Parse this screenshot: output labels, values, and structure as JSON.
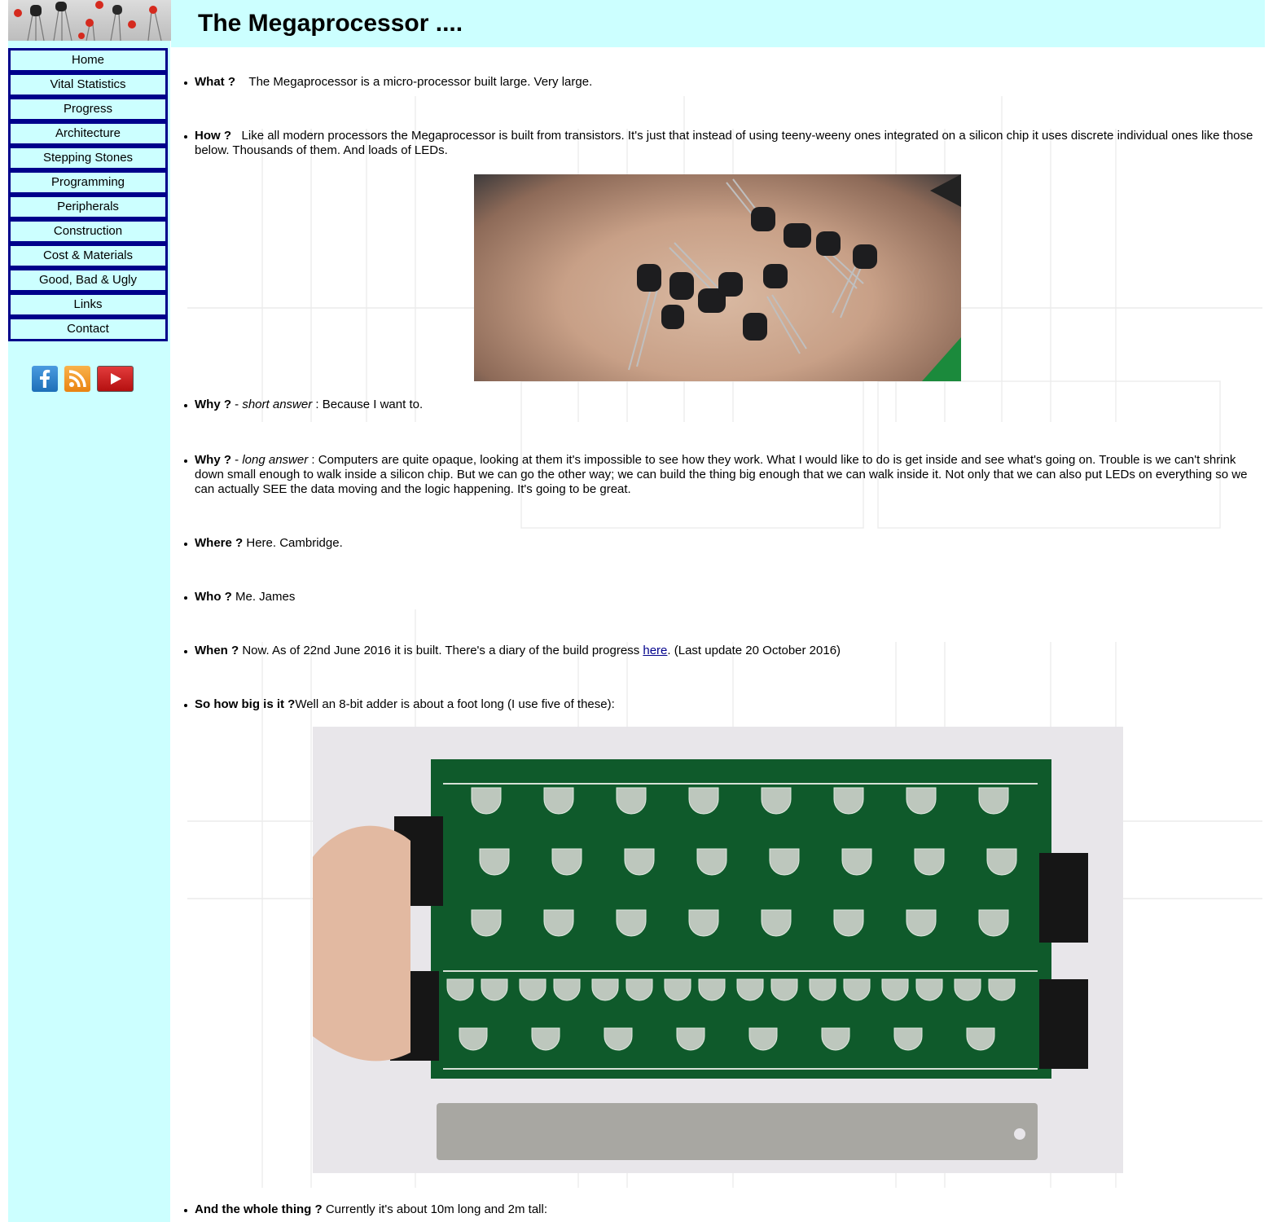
{
  "header": {
    "title": "The Megaprocessor ...."
  },
  "nav": {
    "items": [
      {
        "label": "Home"
      },
      {
        "label": "Vital Statistics"
      },
      {
        "label": "Progress"
      },
      {
        "label": "Architecture"
      },
      {
        "label": "Stepping Stones"
      },
      {
        "label": "Programming"
      },
      {
        "label": "Peripherals"
      },
      {
        "label": "Construction"
      },
      {
        "label": "Cost & Materials"
      },
      {
        "label": "Good, Bad & Ugly"
      },
      {
        "label": "Links"
      },
      {
        "label": "Contact"
      }
    ]
  },
  "social": {
    "icons": [
      "facebook-icon",
      "rss-icon",
      "youtube-icon"
    ]
  },
  "colors": {
    "sidebar_bg": "#ccffff",
    "nav_border": "#00008b",
    "link": "#00008b"
  },
  "content": {
    "what": {
      "q": "What ?",
      "a": "The Megaprocessor is a micro-processor built large. Very large."
    },
    "how": {
      "q": "How ?",
      "a": "Like all modern processors the Megaprocessor is built from transistors. It's just that instead of using teeny-weeny ones integrated on a silicon chip it uses discrete individual ones like those below. Thousands of them. And loads of LEDs."
    },
    "why_short": {
      "q": "Why ?",
      "sep": " - ",
      "tag": "short answer",
      "a": " : Because I want to."
    },
    "why_long": {
      "q": "Why ?",
      "sep": " - ",
      "tag": "long answer",
      "a": " : Computers are quite opaque, looking at them it's impossible to see how they work. What I would like to do is get inside and see what's going on.  Trouble is we can't shrink down small enough to walk inside a silicon chip. But we can go the other way; we can build the thing big enough that we can walk inside it. Not only that we can also put LEDs on everything so we can actually SEE the data moving and the logic happening. It's going to be great."
    },
    "where": {
      "q": "Where ?",
      "a": " Here. Cambridge."
    },
    "who": {
      "q": "Who ?",
      "a": " Me. James"
    },
    "when": {
      "q": "When ?",
      "a_before": " Now. As of 22nd June 2016 it is built. There's a diary of the build progress ",
      "link": "here",
      "a_after": ". (Last update 20 October 2016)"
    },
    "how_big": {
      "q": "So how big is it ?",
      "a": "Well an 8-bit adder is about a foot long (I use five of these):"
    },
    "whole": {
      "q": "And the whole thing ?",
      "a": " Currently it's about 10m long and 2m tall:"
    }
  }
}
